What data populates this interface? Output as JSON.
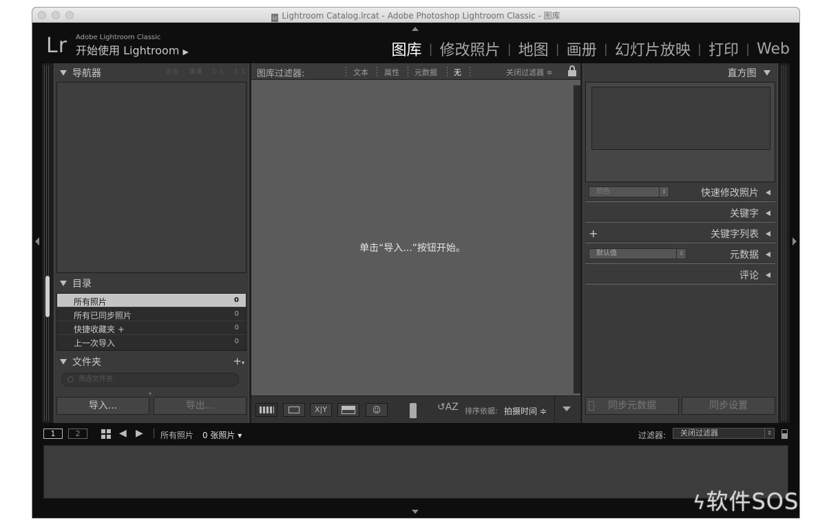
{
  "window": {
    "title": "Lightroom Catalog.lrcat - Adobe Photoshop Lightroom Classic - 图库",
    "doc_icon": "Lr"
  },
  "identity": {
    "logo": "Lr",
    "product": "Adobe Lightroom Classic",
    "start": "开始使用 Lightroom"
  },
  "modules": [
    "图库",
    "修改照片",
    "地图",
    "画册",
    "幻灯片放映",
    "打印",
    "Web"
  ],
  "active_module": "图库",
  "left_panel": {
    "navigator_title": "导航器",
    "navigator_zoom": [
      "适合",
      "填满",
      "1:1",
      "3:1"
    ],
    "catalog_title": "目录",
    "catalog_items": [
      {
        "label": "所有照片",
        "count": "0"
      },
      {
        "label": "所有已同步照片",
        "count": "0"
      },
      {
        "label": "快捷收藏夹 +",
        "count": "0"
      },
      {
        "label": "上一次导入",
        "count": "0"
      }
    ],
    "folders_title": "文件夹",
    "folder_search_placeholder": "筛选文件夹",
    "import_label": "导入...",
    "export_label": "导出..."
  },
  "center": {
    "filter_title": "图库过滤器:",
    "filter_options": [
      "文本",
      "属性",
      "元数据",
      "无"
    ],
    "filter_close": "关闭过滤器 ≑",
    "empty_message": "单击“导入...”按钮开始。",
    "sort_label": "排序依据:",
    "sort_value": "拍摄时间 ≑"
  },
  "right_panel": {
    "histogram_title": "直方图",
    "quick_develop_title": "快速修改照片",
    "quick_develop_preset": "颜色",
    "keywords_title": "关键字",
    "keyword_list_title": "关键字列表",
    "metadata_title": "元数据",
    "metadata_preset": "默认值",
    "comments_title": "评论",
    "sync_metadata_label": "同步元数据",
    "sync_settings_label": "同步设置"
  },
  "filmstrip": {
    "screen1": "1",
    "screen2": "2",
    "source": "所有照片",
    "count": "0 张照片 ▾",
    "filter_label": "过滤器:",
    "filter_value": "关闭过滤器"
  },
  "watermark": "软件SOS",
  "colors": {
    "panel_bg": "#3a3a3a",
    "center_bg": "#5b5b5b",
    "window_bg": "#0e0e0e"
  }
}
